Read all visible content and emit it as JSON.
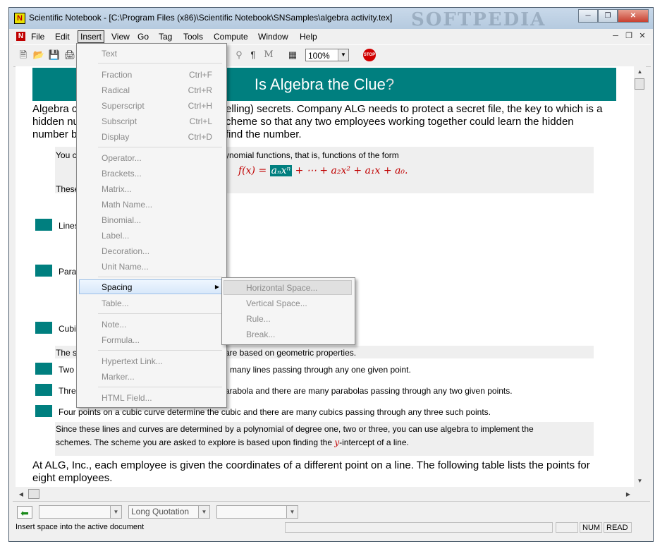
{
  "window": {
    "title": "Scientific Notebook - [C:\\Program Files (x86)\\Scientific Notebook\\SNSamples\\algebra activity.tex]",
    "watermark": "SOFTPEDIA"
  },
  "menubar": {
    "items": [
      "File",
      "Edit",
      "Insert",
      "View",
      "Go",
      "Tag",
      "Tools",
      "Compute",
      "Window",
      "Help"
    ],
    "active": "Insert"
  },
  "toolbar": {
    "zoom": "100%"
  },
  "document": {
    "banner_title": "Is Algebra the Clue",
    "banner_q": "?",
    "intro_line1_a": "Algebra c",
    "intro_line1_b": "elling) secrets. Company ALG needs to protect a secret file, the key to which is a",
    "intro_line2_a": "hidden nu",
    "intro_line2_b": "cheme so that any two employees working together could learn the hidden",
    "intro_line3_a": "number b",
    "intro_line3_b": "find the number.",
    "box1_a": "You c",
    "box1_b": "ynomial functions, that is, functions of the form",
    "formula_lhs": "f(x) = ",
    "formula_hl": "aₙxⁿ",
    "formula_rhs": " + ⋯ + a₂x² + a₁x + a₀.",
    "box1_these": "These",
    "lines_label": "Lines",
    "parabola_label": "Para",
    "cubic_label": "Cubi",
    "schemes_a": "The s",
    "schemes_b": "are based on geometric properties.",
    "two_a": "Two",
    "two_b": "many lines passing through any one given point.",
    "three_a": "Thre",
    "three_b": "arabola and there are many parabolas passing through any two given points.",
    "four_full": "Four points on a cubic curve determine the cubic and there are many cubics passing through any three such points.",
    "since_line1": "Since these lines and curves are determined by a polynomial of degree one, two or three, you can use algebra to implement the",
    "since_line2_a": "schemes. The scheme you are asked to explore is based upon finding the ",
    "since_line2_y": "y",
    "since_line2_b": "-intercept of a line.",
    "alg_line1": "At ALG, Inc., each employee is given the coordinates of a different point on a line. The following table lists the points for",
    "alg_line2": "eight employees."
  },
  "insert_menu": {
    "items": [
      {
        "label": "Text",
        "shortcut": ""
      },
      {
        "label": "Fraction",
        "shortcut": "Ctrl+F"
      },
      {
        "label": "Radical",
        "shortcut": "Ctrl+R"
      },
      {
        "label": "Superscript",
        "shortcut": "Ctrl+H"
      },
      {
        "label": "Subscript",
        "shortcut": "Ctrl+L"
      },
      {
        "label": "Display",
        "shortcut": "Ctrl+D"
      },
      {
        "label": "Operator...",
        "shortcut": ""
      },
      {
        "label": "Brackets...",
        "shortcut": ""
      },
      {
        "label": "Matrix...",
        "shortcut": ""
      },
      {
        "label": "Math Name...",
        "shortcut": ""
      },
      {
        "label": "Binomial...",
        "shortcut": ""
      },
      {
        "label": "Label...",
        "shortcut": ""
      },
      {
        "label": "Decoration...",
        "shortcut": ""
      },
      {
        "label": "Unit Name...",
        "shortcut": ""
      },
      {
        "label": "Spacing",
        "shortcut": ""
      },
      {
        "label": "Table...",
        "shortcut": ""
      },
      {
        "label": "Note...",
        "shortcut": ""
      },
      {
        "label": "Formula...",
        "shortcut": ""
      },
      {
        "label": "Hypertext Link...",
        "shortcut": ""
      },
      {
        "label": "Marker...",
        "shortcut": ""
      },
      {
        "label": "HTML Field...",
        "shortcut": ""
      }
    ]
  },
  "spacing_submenu": {
    "items": [
      "Horizontal Space...",
      "Vertical Space...",
      "Rule...",
      "Break..."
    ]
  },
  "bottom_toolbar": {
    "tag_combo": "Long Quotation"
  },
  "statusbar": {
    "message": "Insert space into the active document",
    "num": "NUM",
    "read": "READ"
  }
}
